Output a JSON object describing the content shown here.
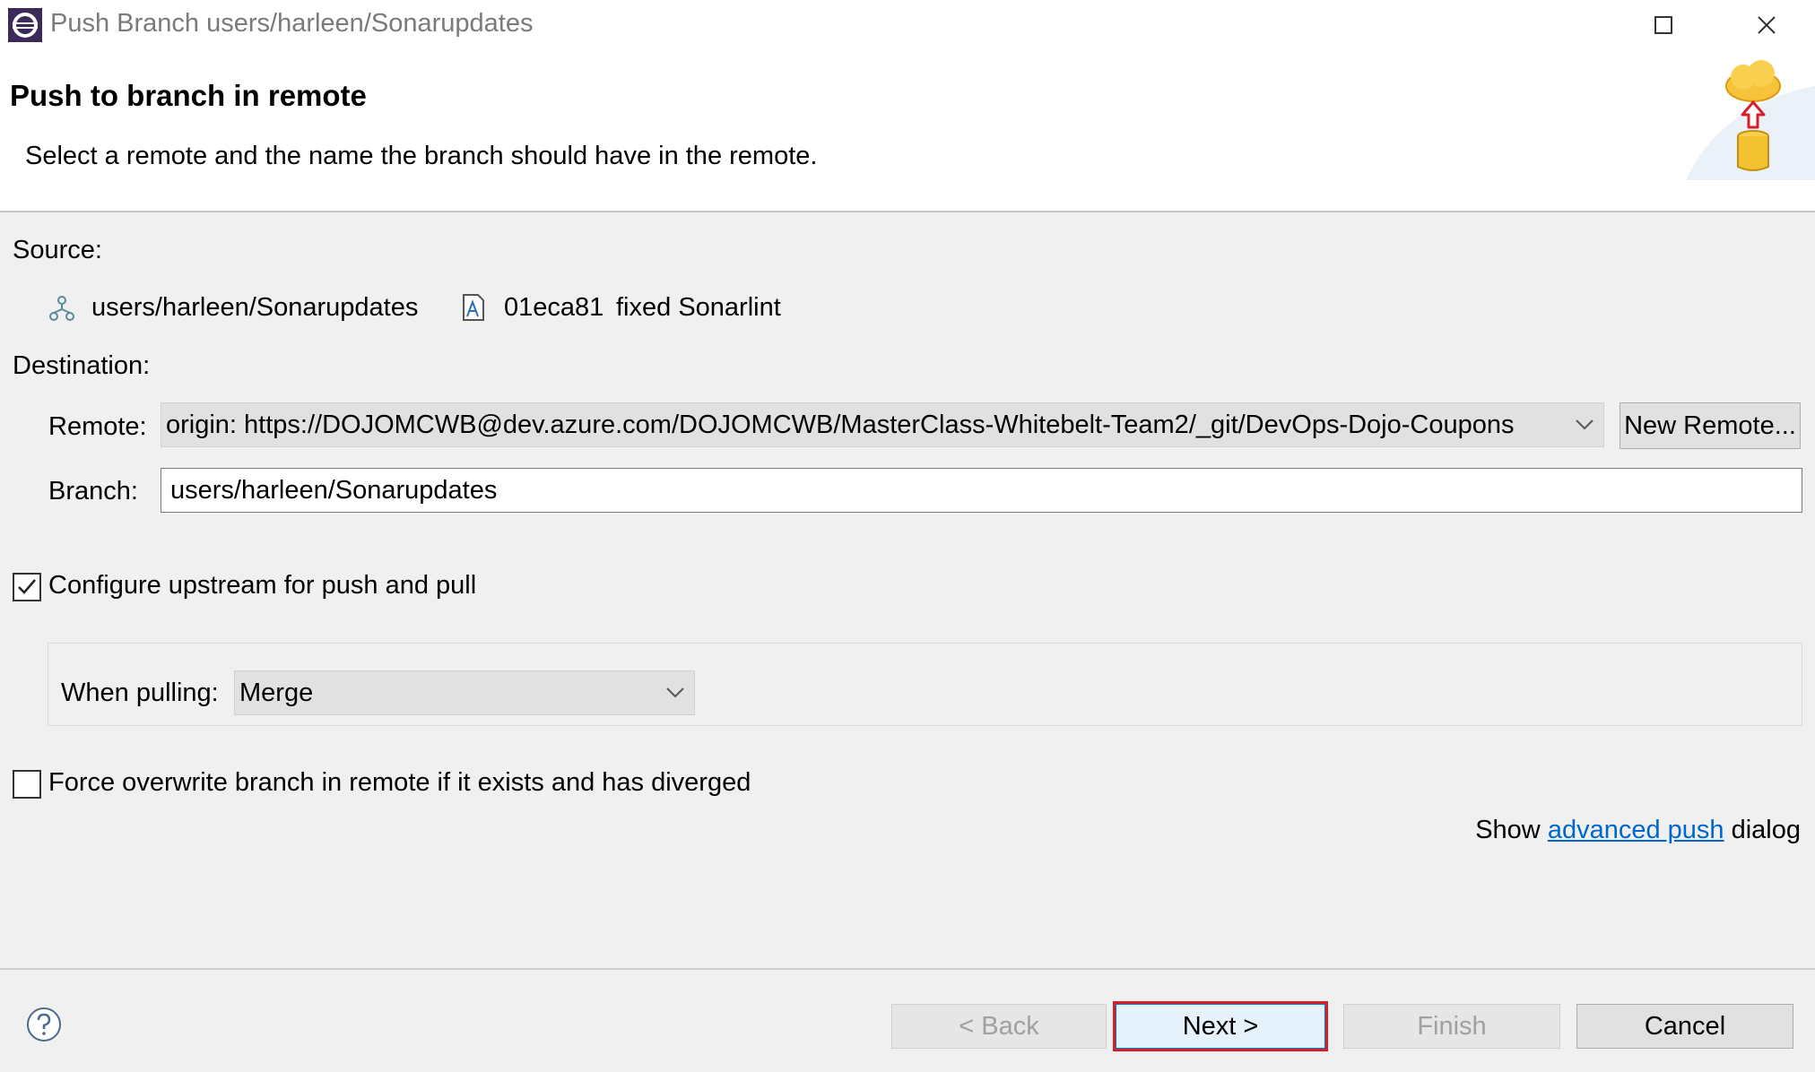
{
  "window": {
    "title": "Push Branch users/harleen/Sonarupdates",
    "maximize_icon": "maximize-icon",
    "close_icon": "close-icon"
  },
  "banner": {
    "title": "Push to branch in remote",
    "description": "Select a remote and the name the branch should have in the remote."
  },
  "source": {
    "label": "Source:",
    "branch": "users/harleen/Sonarupdates",
    "commit_id": "01eca81",
    "commit_message": "fixed Sonarlint"
  },
  "destination": {
    "label": "Destination:",
    "remote_label": "Remote:",
    "remote_value": "origin: https://DOJOMCWB@dev.azure.com/DOJOMCWB/MasterClass-Whitebelt-Team2/_git/DevOps-Dojo-Coupons",
    "new_remote_button": "New Remote...",
    "branch_label": "Branch:",
    "branch_value": "users/harleen/Sonarupdates"
  },
  "upstream": {
    "checkbox_label": "Configure upstream for push and pull",
    "checked": true,
    "when_pulling_label": "When pulling:",
    "when_pulling_value": "Merge"
  },
  "force": {
    "checkbox_label": "Force overwrite branch in remote if it exists and has diverged",
    "checked": false
  },
  "advanced": {
    "prefix": "Show",
    "link": "advanced push",
    "suffix": "dialog"
  },
  "buttons": {
    "back": "< Back",
    "next": "Next >",
    "finish": "Finish",
    "cancel": "Cancel"
  },
  "colors": {
    "accent_link": "#0066cc",
    "highlight": "#d41f2a"
  }
}
